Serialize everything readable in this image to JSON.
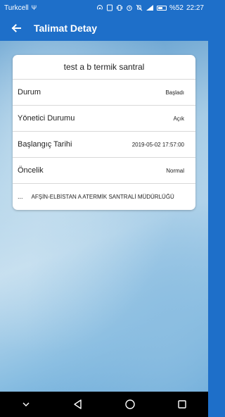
{
  "status_bar": {
    "carrier": "Turkcell",
    "battery_percent": "%52",
    "time": "22:27"
  },
  "app_bar": {
    "title": "Talimat Detay"
  },
  "card": {
    "title": "test a b termik santral",
    "rows": [
      {
        "label": "Durum",
        "value": "Başladı"
      },
      {
        "label": "Yönetici Durumu",
        "value": "Açık"
      },
      {
        "label": "Başlangıç Tarihi",
        "value": "2019-05-02 17:57:00"
      },
      {
        "label": "Öncelik",
        "value": "Normal"
      }
    ],
    "footer_prefix": "...",
    "footer_text": "AFŞİN-ELBİSTAN A ATERMİK SANTRALİ MÜDÜRLÜĞÜ"
  },
  "colors": {
    "primary": "#1e6fc9",
    "card": "#ffffff",
    "nav_bar": "#000000"
  }
}
